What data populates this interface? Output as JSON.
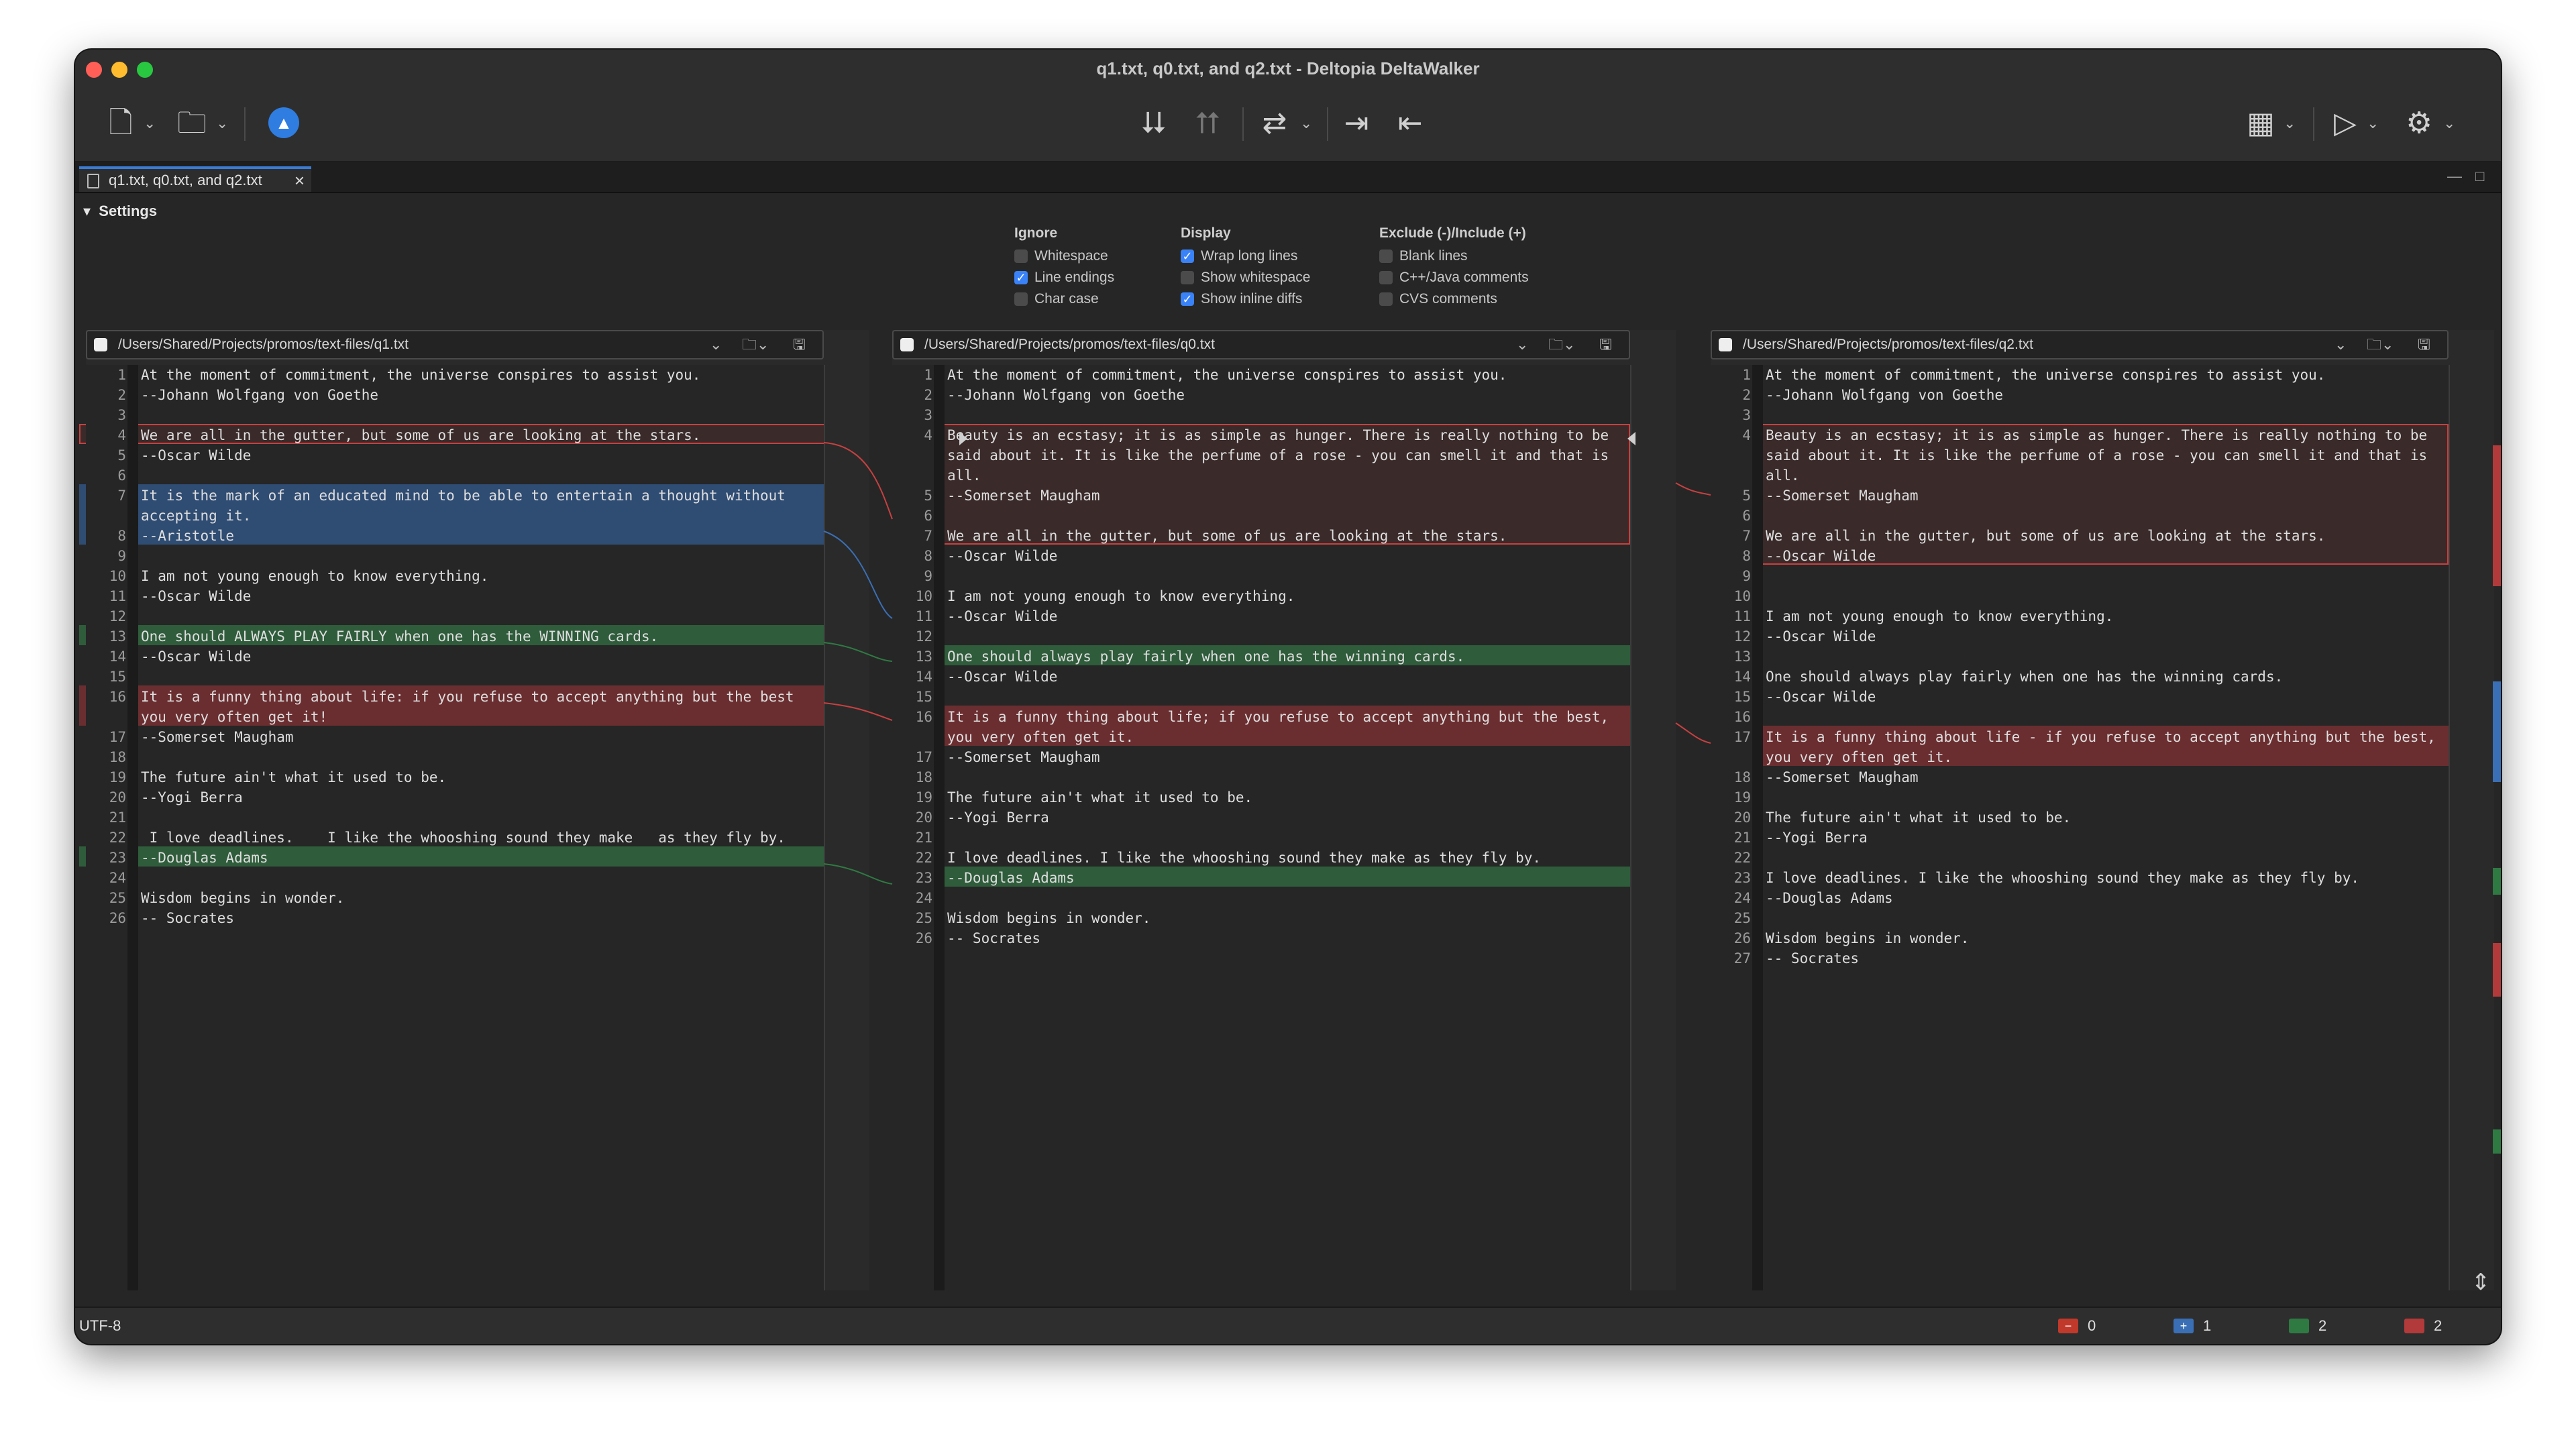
{
  "window": {
    "title": "q1.txt, q0.txt, and q2.txt - Deltopia DeltaWalker"
  },
  "tab": {
    "label": "q1.txt, q0.txt, and q2.txt",
    "close": "×"
  },
  "settings": {
    "label": "Settings",
    "ignore": {
      "title": "Ignore",
      "options": [
        {
          "label": "Whitespace",
          "checked": false
        },
        {
          "label": "Line endings",
          "checked": true
        },
        {
          "label": "Char case",
          "checked": false
        }
      ]
    },
    "display": {
      "title": "Display",
      "options": [
        {
          "label": "Wrap long lines",
          "checked": true
        },
        {
          "label": "Show whitespace",
          "checked": false
        },
        {
          "label": "Show inline diffs",
          "checked": true
        }
      ]
    },
    "exclude": {
      "title": "Exclude (-)/Include (+)",
      "options": [
        {
          "label": "Blank lines",
          "checked": false
        },
        {
          "label": "C++/Java comments",
          "checked": false
        },
        {
          "label": "CVS comments",
          "checked": false
        }
      ]
    }
  },
  "panes": [
    {
      "path": "/Users/Shared/Projects/promos/text-files/q1.txt",
      "rows": [
        {
          "n": "1",
          "t": "At the moment of commitment, the universe conspires to assist you."
        },
        {
          "n": "2",
          "t": "--Johann Wolfgang von Goethe"
        },
        {
          "n": "3",
          "t": ""
        },
        {
          "n": "4",
          "t": "We are all in the gutter, but some of us are looking at the stars."
        },
        {
          "n": "5",
          "t": "--Oscar Wilde"
        },
        {
          "n": "6",
          "t": ""
        },
        {
          "n": "7",
          "t": "It is the mark of an educated mind to be able to entertain a thought without accepting it."
        },
        {
          "n": "8",
          "t": "--Aristotle"
        },
        {
          "n": "9",
          "t": ""
        },
        {
          "n": "10",
          "t": "I am not young enough to know everything."
        },
        {
          "n": "11",
          "t": "--Oscar Wilde"
        },
        {
          "n": "12",
          "t": ""
        },
        {
          "n": "13",
          "t": "One should ALWAYS PLAY FAIRLY when one has the WINNING cards."
        },
        {
          "n": "14",
          "t": "--Oscar Wilde"
        },
        {
          "n": "15",
          "t": ""
        },
        {
          "n": "16",
          "t": "It is a funny thing about life: if you refuse to accept anything but the best you very often get it!"
        },
        {
          "n": "17",
          "t": "--Somerset Maugham"
        },
        {
          "n": "18",
          "t": ""
        },
        {
          "n": "19",
          "t": "The future ain't what it used to be."
        },
        {
          "n": "20",
          "t": "--Yogi Berra"
        },
        {
          "n": "21",
          "t": ""
        },
        {
          "n": "22",
          "t": " I love deadlines.    I like the whooshing sound they make   as they fly by."
        },
        {
          "n": "23",
          "t": "--Douglas Adams"
        },
        {
          "n": "24",
          "t": ""
        },
        {
          "n": "25",
          "t": "Wisdom begins in wonder."
        },
        {
          "n": "26",
          "t": "-- Socrates"
        }
      ]
    },
    {
      "path": "/Users/Shared/Projects/promos/text-files/q0.txt",
      "rows": [
        {
          "n": "1",
          "t": "At the moment of commitment, the universe conspires to assist you."
        },
        {
          "n": "2",
          "t": "--Johann Wolfgang von Goethe"
        },
        {
          "n": "3",
          "t": ""
        },
        {
          "n": "4",
          "t": "Beauty is an ecstasy; it is as simple as hunger. There is really nothing to be said about it. It is like the perfume of a rose - you can smell it and that is all."
        },
        {
          "n": "5",
          "t": "--Somerset Maugham"
        },
        {
          "n": "6",
          "t": ""
        },
        {
          "n": "7",
          "t": "We are all in the gutter, but some of us are looking at the stars."
        },
        {
          "n": "8",
          "t": "--Oscar Wilde"
        },
        {
          "n": "9",
          "t": ""
        },
        {
          "n": "10",
          "t": "I am not young enough to know everything."
        },
        {
          "n": "11",
          "t": "--Oscar Wilde"
        },
        {
          "n": "12",
          "t": ""
        },
        {
          "n": "13",
          "t": "One should always play fairly when one has the winning cards."
        },
        {
          "n": "14",
          "t": "--Oscar Wilde"
        },
        {
          "n": "15",
          "t": ""
        },
        {
          "n": "16",
          "t": "It is a funny thing about life; if you refuse to accept anything but the best, you very often get it."
        },
        {
          "n": "17",
          "t": "--Somerset Maugham"
        },
        {
          "n": "18",
          "t": ""
        },
        {
          "n": "19",
          "t": "The future ain't what it used to be."
        },
        {
          "n": "20",
          "t": "--Yogi Berra"
        },
        {
          "n": "21",
          "t": ""
        },
        {
          "n": "22",
          "t": "I love deadlines. I like the whooshing sound they make as they fly by."
        },
        {
          "n": "23",
          "t": "--Douglas Adams"
        },
        {
          "n": "24",
          "t": ""
        },
        {
          "n": "25",
          "t": "Wisdom begins in wonder."
        },
        {
          "n": "26",
          "t": "-- Socrates"
        }
      ]
    },
    {
      "path": "/Users/Shared/Projects/promos/text-files/q2.txt",
      "rows": [
        {
          "n": "1",
          "t": "At the moment of commitment, the universe conspires to assist you."
        },
        {
          "n": "2",
          "t": "--Johann Wolfgang von Goethe"
        },
        {
          "n": "3",
          "t": ""
        },
        {
          "n": "4",
          "t": "Beauty is an ecstasy; it is as simple as hunger. There is really nothing to be said about it. It is like the perfume of a rose - you can smell it and that is all."
        },
        {
          "n": "5",
          "t": "--Somerset Maugham"
        },
        {
          "n": "6",
          "t": ""
        },
        {
          "n": "7",
          "t": "We are all in the gutter, but some of us are looking at the stars."
        },
        {
          "n": "8",
          "t": "--Oscar Wilde"
        },
        {
          "n": "9",
          "t": ""
        },
        {
          "n": "10",
          "t": ""
        },
        {
          "n": "11",
          "t": "I am not young enough to know everything."
        },
        {
          "n": "12",
          "t": "--Oscar Wilde"
        },
        {
          "n": "13",
          "t": ""
        },
        {
          "n": "14",
          "t": "One should always play fairly when one has the winning cards."
        },
        {
          "n": "15",
          "t": "--Oscar Wilde"
        },
        {
          "n": "16",
          "t": ""
        },
        {
          "n": "17",
          "t": "It is a funny thing about life - if you refuse to accept anything but the best, you very often get it."
        },
        {
          "n": "18",
          "t": "--Somerset Maugham"
        },
        {
          "n": "19",
          "t": ""
        },
        {
          "n": "20",
          "t": "The future ain't what it used to be."
        },
        {
          "n": "21",
          "t": "--Yogi Berra"
        },
        {
          "n": "22",
          "t": ""
        },
        {
          "n": "23",
          "t": "I love deadlines. I like the whooshing sound they make as they fly by."
        },
        {
          "n": "24",
          "t": "--Douglas Adams"
        },
        {
          "n": "25",
          "t": ""
        },
        {
          "n": "26",
          "t": "Wisdom begins in wonder."
        },
        {
          "n": "27",
          "t": "-- Socrates"
        }
      ]
    }
  ],
  "status": {
    "encoding": "UTF-8",
    "counts": [
      {
        "symbol": "−",
        "value": "0",
        "color": "#c0392b"
      },
      {
        "symbol": "+",
        "value": "1",
        "color": "#3a6fb5"
      },
      {
        "symbol": "",
        "value": "2",
        "color": "#2f7a43"
      },
      {
        "symbol": "",
        "value": "2",
        "color": "#b33a3a"
      }
    ]
  },
  "colors": {
    "changed": "#6b2e30",
    "added": "#2f4c73",
    "moved": "#2f5c3b",
    "accent": "#3a82f7"
  }
}
